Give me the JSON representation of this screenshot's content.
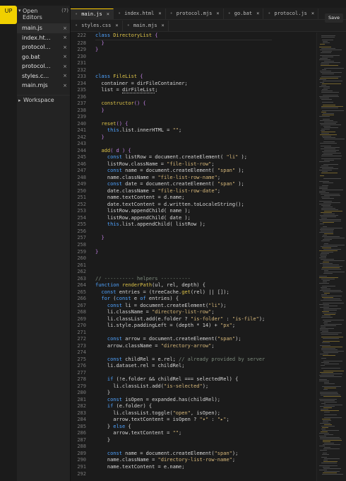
{
  "up_button": "UP",
  "sidebar": {
    "open_editors": {
      "title": "Open Editors",
      "count": "(7)"
    },
    "files": [
      {
        "name": "main.js",
        "close": "×",
        "active": true
      },
      {
        "name": "index.ht…",
        "close": "×",
        "active": false
      },
      {
        "name": "protocol…",
        "close": "×",
        "active": false
      },
      {
        "name": "go.bat",
        "close": "×",
        "active": false
      },
      {
        "name": "protocol…",
        "close": "×",
        "active": false
      },
      {
        "name": "styles.c…",
        "close": "×",
        "active": false
      },
      {
        "name": "main.mjs",
        "close": "×",
        "active": false
      }
    ],
    "workspace": {
      "title": "Workspace"
    }
  },
  "tabs": {
    "row1": [
      {
        "label": "main.js",
        "close": "×",
        "active": true
      },
      {
        "label": "index.html",
        "close": "×",
        "active": false
      },
      {
        "label": "protocol.mjs",
        "close": "×",
        "active": false
      },
      {
        "label": "go.bat",
        "close": "×",
        "active": false
      },
      {
        "label": "protocol.js",
        "close": "×",
        "active": false
      }
    ],
    "row2": [
      {
        "label": "styles.css",
        "close": "×",
        "active": false
      },
      {
        "label": "main.mjs",
        "close": "×",
        "active": false
      }
    ]
  },
  "toolbar": {
    "save_label": "Save"
  },
  "colors": {
    "keyword": "#4fa3ff",
    "class_name": "#dcc248",
    "function": "#dcc248",
    "string": "#d7b87a",
    "comment": "#7c8a7c",
    "punct": "#bf7fe0",
    "text": "#d6d6d6",
    "accent": "#ffcc00"
  },
  "code_lines": [
    {
      "n": "222",
      "t": [
        [
          "k",
          "class "
        ],
        [
          "c",
          "DirectoryList"
        ],
        [
          "p",
          " {"
        ]
      ]
    },
    {
      "n": "228",
      "t": [
        [
          "x",
          "  "
        ],
        [
          "p",
          "}"
        ]
      ]
    },
    {
      "n": "229",
      "t": [
        [
          "p",
          "}"
        ]
      ]
    },
    {
      "n": "230",
      "t": []
    },
    {
      "n": "231",
      "t": []
    },
    {
      "n": "232",
      "t": []
    },
    {
      "n": "233",
      "t": [
        [
          "k",
          "class "
        ],
        [
          "c",
          "FileList"
        ],
        [
          "p",
          " {"
        ]
      ]
    },
    {
      "n": "234",
      "t": [
        [
          "x",
          "  container = dirFileContainer;"
        ]
      ]
    },
    {
      "n": "235",
      "t": [
        [
          "x",
          "  list = "
        ],
        [
          "u",
          "dirFileList"
        ],
        [
          "x",
          ";"
        ]
      ]
    },
    {
      "n": "236",
      "t": []
    },
    {
      "n": "237",
      "t": [
        [
          "x",
          "  "
        ],
        [
          "f",
          "constructor"
        ],
        [
          "p",
          "() {"
        ]
      ]
    },
    {
      "n": "238",
      "t": [
        [
          "x",
          "  "
        ],
        [
          "p",
          "}"
        ]
      ]
    },
    {
      "n": "239",
      "t": []
    },
    {
      "n": "240",
      "t": [
        [
          "x",
          "  "
        ],
        [
          "f",
          "reset"
        ],
        [
          "p",
          "() {"
        ]
      ]
    },
    {
      "n": "241",
      "t": [
        [
          "x",
          "    "
        ],
        [
          "k",
          "this"
        ],
        [
          "x",
          ".list.innerHTML = "
        ],
        [
          "s",
          "\"\""
        ],
        [
          "x",
          ";"
        ]
      ]
    },
    {
      "n": "242",
      "t": [
        [
          "x",
          "  "
        ],
        [
          "p",
          "}"
        ]
      ]
    },
    {
      "n": "243",
      "t": []
    },
    {
      "n": "244",
      "t": [
        [
          "x",
          "  "
        ],
        [
          "f",
          "add"
        ],
        [
          "p",
          "( d ) {"
        ]
      ]
    },
    {
      "n": "245",
      "t": [
        [
          "x",
          "    "
        ],
        [
          "k",
          "const "
        ],
        [
          "x",
          "listRow = document.createElement( "
        ],
        [
          "s",
          "\"li\""
        ],
        [
          "x",
          " );"
        ]
      ]
    },
    {
      "n": "246",
      "t": [
        [
          "x",
          "    listRow.className = "
        ],
        [
          "s",
          "\"file-list-row\""
        ],
        [
          "x",
          ";"
        ]
      ]
    },
    {
      "n": "247",
      "t": [
        [
          "x",
          "    "
        ],
        [
          "k",
          "const "
        ],
        [
          "x",
          "name = document.createElement( "
        ],
        [
          "s",
          "\"span\""
        ],
        [
          "x",
          " );"
        ]
      ]
    },
    {
      "n": "248",
      "t": [
        [
          "x",
          "    name.className = "
        ],
        [
          "s",
          "\"file-list-row-name\""
        ],
        [
          "x",
          ";"
        ]
      ]
    },
    {
      "n": "249",
      "t": [
        [
          "x",
          "    "
        ],
        [
          "k",
          "const "
        ],
        [
          "x",
          "date = document.createElement( "
        ],
        [
          "s",
          "\"span\""
        ],
        [
          "x",
          " );"
        ]
      ]
    },
    {
      "n": "250",
      "t": [
        [
          "x",
          "    date.className = "
        ],
        [
          "s",
          "\"file-list-row-date\""
        ],
        [
          "x",
          ";"
        ]
      ]
    },
    {
      "n": "251",
      "t": [
        [
          "x",
          "    name.textContent = d.name;"
        ]
      ]
    },
    {
      "n": "252",
      "t": [
        [
          "x",
          "    date.textContent = d.written.toLocaleString();"
        ]
      ]
    },
    {
      "n": "253",
      "t": [
        [
          "x",
          "    listRow.appendChild( name );"
        ]
      ]
    },
    {
      "n": "254",
      "t": [
        [
          "x",
          "    listRow.appendChild( date );"
        ]
      ]
    },
    {
      "n": "255",
      "t": [
        [
          "x",
          "    "
        ],
        [
          "k",
          "this"
        ],
        [
          "x",
          ".list.appendChild( listRow );"
        ]
      ]
    },
    {
      "n": "256",
      "t": []
    },
    {
      "n": "257",
      "t": [
        [
          "x",
          "  "
        ],
        [
          "p",
          "}"
        ]
      ]
    },
    {
      "n": "258",
      "t": []
    },
    {
      "n": "259",
      "t": [
        [
          "p",
          "}"
        ]
      ]
    },
    {
      "n": "260",
      "t": []
    },
    {
      "n": "261",
      "t": []
    },
    {
      "n": "262",
      "t": []
    },
    {
      "n": "263",
      "t": [
        [
          "m",
          "// ---------- helpers ----------"
        ]
      ]
    },
    {
      "n": "264",
      "t": [
        [
          "k",
          "function "
        ],
        [
          "f",
          "renderPath"
        ],
        [
          "x",
          "(ul, rel, depth) {"
        ]
      ]
    },
    {
      "n": "265",
      "t": [
        [
          "x",
          "  "
        ],
        [
          "k",
          "const "
        ],
        [
          "x",
          "entries = (treeCache."
        ],
        [
          "f",
          "get"
        ],
        [
          "x",
          "(rel) || []);"
        ]
      ]
    },
    {
      "n": "266",
      "t": [
        [
          "x",
          "  "
        ],
        [
          "k",
          "for "
        ],
        [
          "x",
          "("
        ],
        [
          "k",
          "const "
        ],
        [
          "x",
          "e "
        ],
        [
          "k",
          "of "
        ],
        [
          "x",
          "entries) {"
        ]
      ]
    },
    {
      "n": "267",
      "t": [
        [
          "x",
          "    "
        ],
        [
          "k",
          "const "
        ],
        [
          "x",
          "li = document.createElement("
        ],
        [
          "s",
          "\"li\""
        ],
        [
          "x",
          ");"
        ]
      ]
    },
    {
      "n": "268",
      "t": [
        [
          "x",
          "    li.className = "
        ],
        [
          "s",
          "\"directory-list-row\""
        ],
        [
          "x",
          ";"
        ]
      ]
    },
    {
      "n": "269",
      "t": [
        [
          "x",
          "    li.classList.add(e.folder ? "
        ],
        [
          "s",
          "\"is-folder\""
        ],
        [
          "x",
          " : "
        ],
        [
          "s",
          "\"is-file\""
        ],
        [
          "x",
          ");"
        ]
      ]
    },
    {
      "n": "270",
      "t": [
        [
          "x",
          "    li.style.paddingLeft = (depth * 14) + "
        ],
        [
          "s",
          "\"px\""
        ],
        [
          "x",
          ";"
        ]
      ]
    },
    {
      "n": "271",
      "t": []
    },
    {
      "n": "272",
      "t": [
        [
          "x",
          "    "
        ],
        [
          "k",
          "const "
        ],
        [
          "x",
          "arrow = document.createElement("
        ],
        [
          "s",
          "\"span\""
        ],
        [
          "x",
          ");"
        ]
      ]
    },
    {
      "n": "273",
      "t": [
        [
          "x",
          "    arrow.className = "
        ],
        [
          "s",
          "\"directory-arrow\""
        ],
        [
          "x",
          ";"
        ]
      ]
    },
    {
      "n": "274",
      "t": []
    },
    {
      "n": "275",
      "t": [
        [
          "x",
          "    "
        ],
        [
          "k",
          "const "
        ],
        [
          "x",
          "childRel = e.rel; "
        ],
        [
          "m",
          "// already provided by server"
        ]
      ]
    },
    {
      "n": "276",
      "t": [
        [
          "x",
          "    li.dataset.rel = childRel;"
        ]
      ]
    },
    {
      "n": "277",
      "t": []
    },
    {
      "n": "278",
      "t": [
        [
          "x",
          "    "
        ],
        [
          "k",
          "if "
        ],
        [
          "x",
          "(!e.folder && childRel === selectedRel) {"
        ]
      ]
    },
    {
      "n": "279",
      "t": [
        [
          "x",
          "      li.classList.add("
        ],
        [
          "s",
          "\"is-selected\""
        ],
        [
          "x",
          ");"
        ]
      ]
    },
    {
      "n": "280",
      "t": [
        [
          "x",
          "    }"
        ]
      ]
    },
    {
      "n": "281",
      "t": [
        [
          "x",
          "    "
        ],
        [
          "k",
          "const "
        ],
        [
          "x",
          "isOpen = expanded.has(childRel);"
        ]
      ]
    },
    {
      "n": "282",
      "t": [
        [
          "x",
          "    "
        ],
        [
          "k",
          "if "
        ],
        [
          "x",
          "(e.folder) {"
        ]
      ]
    },
    {
      "n": "283",
      "t": [
        [
          "x",
          "      li.classList.toggle("
        ],
        [
          "s",
          "\"open\""
        ],
        [
          "x",
          ", isOpen);"
        ]
      ]
    },
    {
      "n": "284",
      "t": [
        [
          "x",
          "      arrow.textContent = isOpen ? "
        ],
        [
          "s",
          "\"▾\""
        ],
        [
          "x",
          " : "
        ],
        [
          "s",
          "\"▸\""
        ],
        [
          "x",
          ";"
        ]
      ]
    },
    {
      "n": "285",
      "t": [
        [
          "x",
          "    } "
        ],
        [
          "k",
          "else "
        ],
        [
          "x",
          "{"
        ]
      ]
    },
    {
      "n": "286",
      "t": [
        [
          "x",
          "      arrow.textContent = "
        ],
        [
          "s",
          "\"\""
        ],
        [
          "x",
          ";"
        ]
      ]
    },
    {
      "n": "287",
      "t": [
        [
          "x",
          "    }"
        ]
      ]
    },
    {
      "n": "288",
      "t": []
    },
    {
      "n": "289",
      "t": [
        [
          "x",
          "    "
        ],
        [
          "k",
          "const "
        ],
        [
          "x",
          "name = document.createElement("
        ],
        [
          "s",
          "\"span\""
        ],
        [
          "x",
          ");"
        ]
      ]
    },
    {
      "n": "290",
      "t": [
        [
          "x",
          "    name.className = "
        ],
        [
          "s",
          "\"directory-list-row-name\""
        ],
        [
          "x",
          ";"
        ]
      ]
    },
    {
      "n": "291",
      "t": [
        [
          "x",
          "    name.textContent = e.name;"
        ]
      ]
    },
    {
      "n": "292",
      "t": []
    }
  ]
}
